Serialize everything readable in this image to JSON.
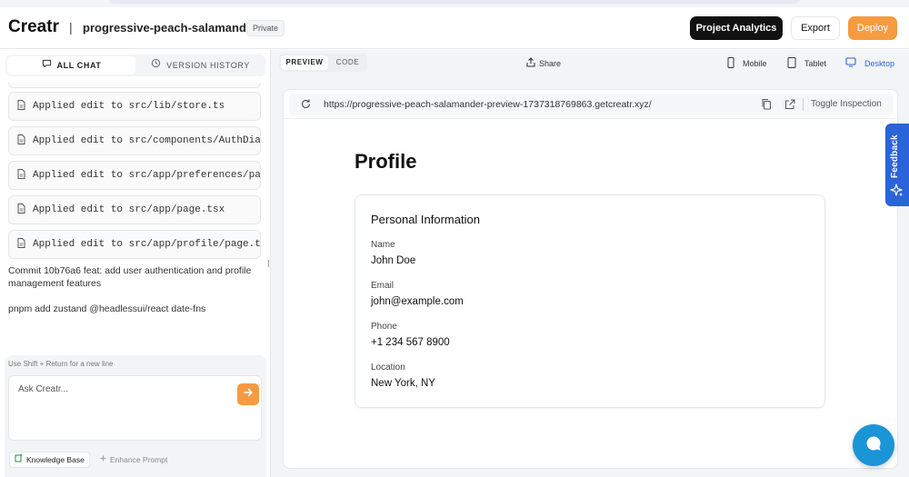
{
  "header": {
    "logo": "Creatr",
    "separator": "|",
    "project_name": "progressive-peach-salamander",
    "visibility_badge": "Private",
    "analytics_button": "Project Analytics",
    "export_button": "Export",
    "deploy_button": "Deploy"
  },
  "left_panel": {
    "tabs": [
      {
        "label": "ALL CHAT",
        "icon": "chat-icon",
        "active": true
      },
      {
        "label": "VERSION HISTORY",
        "icon": "history-icon",
        "active": false
      }
    ],
    "edits": [
      "Applied edit to src/lib/store.ts",
      "Applied edit to src/components/AuthDialog.tsx",
      "Applied edit to src/app/preferences/page.tsx",
      "Applied edit to src/app/page.tsx",
      "Applied edit to src/app/profile/page.tsx"
    ],
    "commit_message": "Commit 10b76a6 feat: add user authentication and profile management features",
    "command_message": "pnpm add zustand @headlessui/react date-fns",
    "composer": {
      "hint": "Use Shift + Return for a new line",
      "placeholder": "Ask Creatr...",
      "knowledge_base": "Knowledge Base",
      "enhance_prompt": "Enhance Prompt"
    }
  },
  "right_panel": {
    "view_tabs": [
      {
        "label": "PREVIEW",
        "active": true
      },
      {
        "label": "CODE",
        "active": false
      }
    ],
    "share": "Share",
    "devices": [
      {
        "label": "Mobile",
        "icon": "mobile-icon",
        "active": false
      },
      {
        "label": "Tablet",
        "icon": "tablet-icon",
        "active": false
      },
      {
        "label": "Desktop",
        "icon": "desktop-icon",
        "active": true
      }
    ],
    "url": "https://progressive-peach-salamander-preview-1737318769863.getcreatr.xyz/",
    "toggle_inspection": "Toggle Inspection"
  },
  "preview": {
    "page_title": "Profile",
    "card_title": "Personal Information",
    "fields": [
      {
        "label": "Name",
        "value": "John Doe"
      },
      {
        "label": "Email",
        "value": "john@example.com"
      },
      {
        "label": "Phone",
        "value": "+1 234 567 8900"
      },
      {
        "label": "Location",
        "value": "New York, NY"
      }
    ]
  },
  "feedback_tab": "Feedback",
  "colors": {
    "accent_orange": "#f59b42",
    "accent_blue": "#2b63d9",
    "chat_fab": "#1a95d8"
  }
}
